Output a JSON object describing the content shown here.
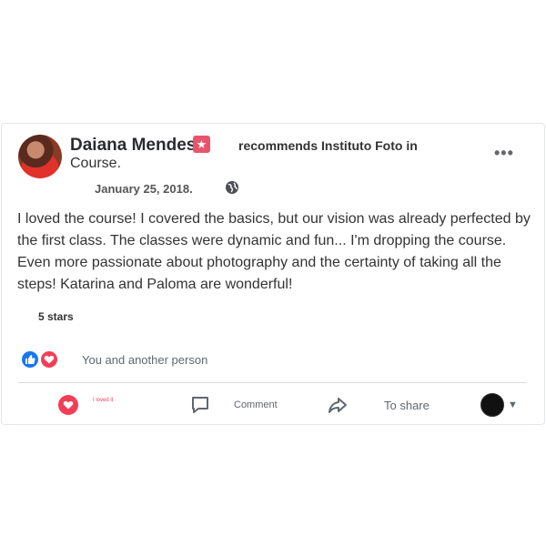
{
  "post": {
    "author": "Daiana Mendes",
    "recommends": "recommends Instituto Foto in",
    "course": "Course.",
    "date": "January 25, 2018.",
    "paragraphs": [
      "I loved the course! I covered the basics, but our vision was already perfected by the first class. The classes were dynamic and fun... I'm dropping the course.",
      "Even more passionate about photography and the certainty of taking all the steps! Katarina and Paloma are wonderful!"
    ],
    "rating": "5 stars"
  },
  "reactions": {
    "summary": "You and another person",
    "icons": [
      "like-icon",
      "love-icon"
    ]
  },
  "actions": {
    "love_label": "I loved it",
    "comment_label": "Comment",
    "share_label": "To share"
  },
  "colors": {
    "like_blue": "#1877f2",
    "love_red": "#f33e58",
    "badge_pink": "#e8546b"
  }
}
